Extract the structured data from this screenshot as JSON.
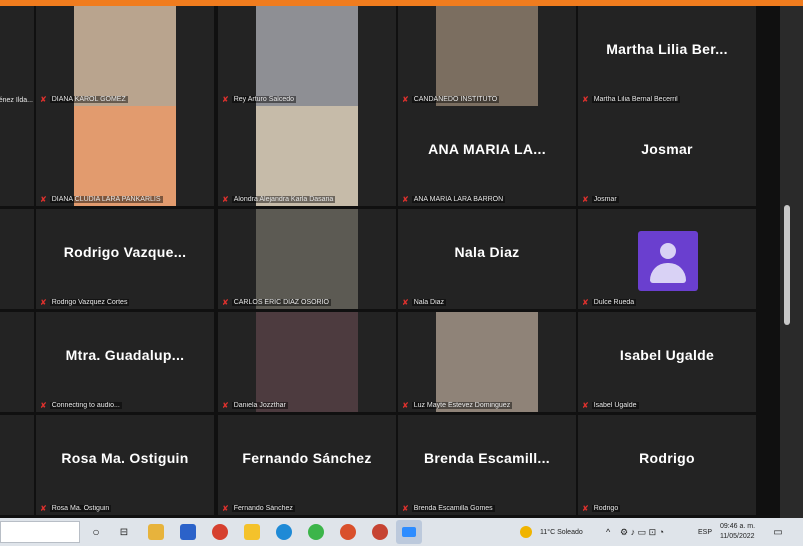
{
  "participants": [
    {
      "display": "",
      "label": "DIANA KAROL GOMEZ",
      "video": "#b9a48e"
    },
    {
      "display": "",
      "label": "Rey Arturo Salcedo",
      "video": "#8e8f94"
    },
    {
      "display": "",
      "label": "CANDANEDO INSTITUTO",
      "video": "#7b6e60"
    },
    {
      "display": "Martha Lilia Ber...",
      "label": "Martha Lilia Bernal Becerril",
      "video": ""
    },
    {
      "display": "",
      "label": "DIANA CLUDIA LARA PANKARLIS",
      "video": "#e29b6e"
    },
    {
      "display": "",
      "label": "Alondra Alejandra Karla Dasaria",
      "video": "#c6bba9"
    },
    {
      "display": "ANA MARIA LA...",
      "label": "ANA MARIA LARA BARRON",
      "video": ""
    },
    {
      "display": "Josmar",
      "label": "Josmar",
      "video": ""
    },
    {
      "display": "Rodrigo Vazque...",
      "label": "Rodrigo Vazquez Cortes",
      "video": ""
    },
    {
      "display": "",
      "label": "CARLOS ERIC DIAZ OSORIO",
      "video": "#5c5a53"
    },
    {
      "display": "Nala Diaz",
      "label": "Nala Diaz",
      "video": ""
    },
    {
      "display": "",
      "label": "Dulce Rueda",
      "video": "avatar"
    },
    {
      "display": "Mtra. Guadalup...",
      "label": "Connecting to audio...",
      "video": ""
    },
    {
      "display": "",
      "label": "Daniela Jozzthar",
      "video": "#4d3b3f"
    },
    {
      "display": "",
      "label": "Luz Mayte Estevez Dominguez",
      "video": "#8f8378"
    },
    {
      "display": "Isabel Ugalde",
      "label": "Isabel Ugalde",
      "video": ""
    },
    {
      "display": "Rosa Ma. Ostiguin",
      "label": "Rosa Ma. Ostiguin",
      "video": ""
    },
    {
      "display": "Fernando Sánchez",
      "label": "Fernando Sánchez",
      "video": ""
    },
    {
      "display": "Brenda Escamill...",
      "label": "Brenda Escamilla Gomes",
      "video": ""
    },
    {
      "display": "Rodrigo",
      "label": "Rodrigo",
      "video": ""
    }
  ],
  "side_labels": [
    "Jiménez Ilda...",
    "",
    "",
    "",
    ""
  ],
  "taskbar": {
    "weather": "11°C Soleado",
    "language": "ESP",
    "time": "09:46 a. m.",
    "date": "11/05/2022"
  },
  "colors": {
    "accent": "#f07c1e",
    "muted_mic": "#e0312d",
    "tile_bg": "#232323",
    "avatar": "#6a3fcf"
  }
}
